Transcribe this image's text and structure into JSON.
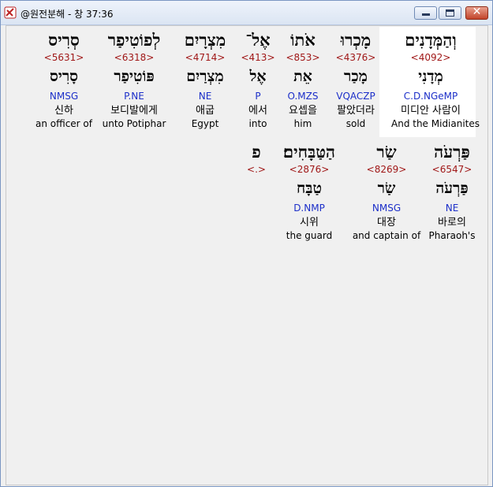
{
  "window": {
    "title": "@원전분해 - 창 37:36",
    "close_symbol": "✕"
  },
  "verse": {
    "row1": [
      {
        "word": "וְהַמְּדָנִים",
        "strong": "<4092>",
        "lemma": "מְדָנִי",
        "morph": "C.D.NGeMP",
        "korean": "미디안 사람이",
        "english": "And the Midianites",
        "highlight": true
      },
      {
        "word": "מָכְרוּ",
        "strong": "<4376>",
        "lemma": "מָכַר",
        "morph": "VQACZP",
        "korean": "팔았더라",
        "english": "sold"
      },
      {
        "word": "אֹתוֹ",
        "strong": "<853>",
        "lemma": "אֵת",
        "morph": "O.MZS",
        "korean": "요셉을",
        "english": "him"
      },
      {
        "word": "אֶל־",
        "strong": "<413>",
        "lemma": "אֶל",
        "morph": "P",
        "korean": "에서",
        "english": "into"
      },
      {
        "word": "מִצְרָיִם",
        "strong": "<4714>",
        "lemma": "מִצְרַיִם",
        "morph": "NE",
        "korean": "애굽",
        "english": "Egypt"
      },
      {
        "word": "לְפוֹטִיפַר",
        "strong": "<6318>",
        "lemma": "פּוֹטִיפַר",
        "morph": "P.NE",
        "korean": "보디발에게",
        "english": "unto Potiphar"
      },
      {
        "word": "סְרִיס",
        "strong": "<5631>",
        "lemma": "סָרִיס",
        "morph": "NMSG",
        "korean": "신하",
        "english": "an officer of"
      }
    ],
    "row2": [
      {
        "word": "פַּרְעֹה",
        "strong": "<6547>",
        "lemma": "פַּרְעֹה",
        "morph": "NE",
        "korean": "바로의",
        "english": "Pharaoh's"
      },
      {
        "word": "שַׂר",
        "strong": "<8269>",
        "lemma": "שַׂר",
        "morph": "NMSG",
        "korean": "대장",
        "english": "and captain of"
      },
      {
        "word": "הַטַּבָּחִים׃",
        "strong": "<2876>",
        "lemma": "טַבָּח",
        "morph": "D.NMP",
        "korean": "시위",
        "english": "the guard"
      },
      {
        "word": "פ",
        "strong": "<.>"
      }
    ]
  }
}
